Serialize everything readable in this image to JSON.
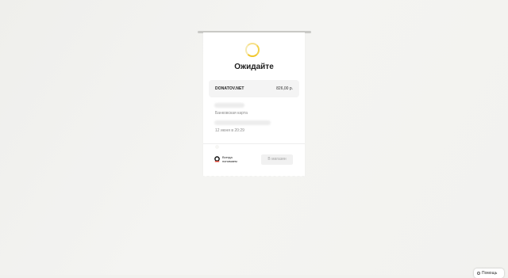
{
  "status": {
    "title": "Ожидайте"
  },
  "merchant": {
    "name": "DONATOV.NET",
    "amount": "826,00 р."
  },
  "payment": {
    "method_label": "Банковская карта",
    "date": "12 июня в 20:29"
  },
  "footer": {
    "logo_icon": "yoomoney-logo-icon",
    "slogan_line1": "Всегда",
    "slogan_line2": "понимаем",
    "shop_button_label": "В магазин"
  },
  "help": {
    "label": "Помощь"
  },
  "colors": {
    "spinner_accent": "#f0c62a",
    "background": "#f1f1ee",
    "card": "#ffffff"
  }
}
